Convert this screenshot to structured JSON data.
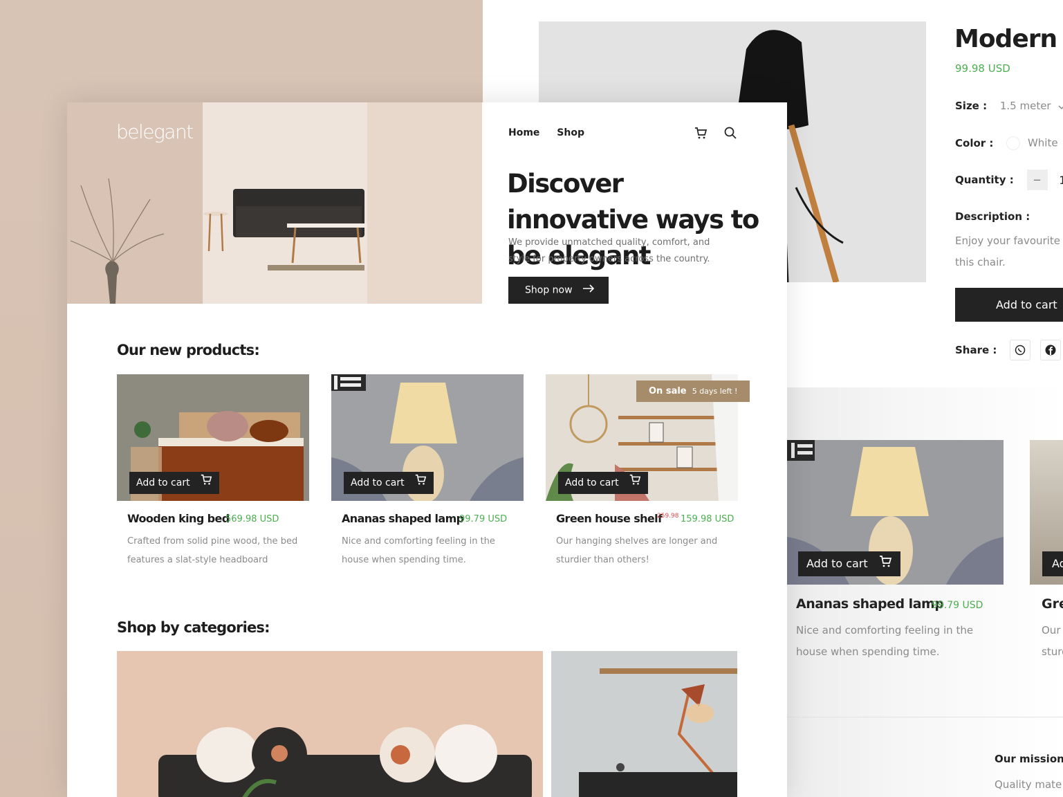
{
  "product_page": {
    "title": "Modern C",
    "price": "99.98  USD",
    "size_label": "Size :",
    "size_value": "1.5 meter",
    "color_label": "Color :",
    "color_value": "White",
    "quantity_label": "Quantity :",
    "quantity_minus": "−",
    "quantity_value": "1",
    "description_label": "Description :",
    "description_text": "Enjoy your favourite this chair.",
    "add_to_cart": "Add to cart",
    "share_label": "Share :",
    "related": [
      {
        "add_to_cart": "Add to cart",
        "name": "Ananas shaped lamp",
        "price": "99.79  USD",
        "description": "Nice and comforting feeling in the house when spending time."
      },
      {
        "add_to_cart": "Ad",
        "name": "Gre",
        "description_1": "Our",
        "description_2": "sturd"
      }
    ],
    "mission_title": "Our mission:",
    "mission_text": "Quality mate"
  },
  "home": {
    "logo": "belegant",
    "nav": [
      "Home",
      "Shop"
    ],
    "hero_title": "Discover innovative ways to be elegant",
    "hero_subtitle": "We provide unmatched quality, comfort, and style for property owners across the country.",
    "shop_now": "Shop now",
    "new_products_title": "Our new products:",
    "products": [
      {
        "name": "Wooden king bed",
        "price": "569.98  USD",
        "old_price": "",
        "description": "Crafted from solid pine wood, the bed features a slat-style headboard",
        "add_to_cart": "Add to cart"
      },
      {
        "name": "Ananas shaped lamp",
        "price": "99.79  USD",
        "old_price": "",
        "description": "Nice and comforting feeling in the house when spending time.",
        "add_to_cart": "Add to cart"
      },
      {
        "name": "Green house shelf",
        "price": "159.98  USD",
        "old_price": "259.98",
        "description": "Our hanging shelves are longer and sturdier than others!",
        "add_to_cart": "Add to cart"
      }
    ],
    "sale_badge": {
      "label": "On sale",
      "detail": "5 days left !"
    },
    "categories_title": "Shop by categories:"
  },
  "colors": {
    "accent_price": "#4caf50",
    "sale_badge": "#a78c6b",
    "old_price": "#e04d4d",
    "button_dark": "#232323"
  },
  "icons": [
    "cart-icon",
    "search-icon",
    "arrow-right-icon",
    "chevron-down-icon",
    "whatsapp-icon",
    "facebook-icon"
  ]
}
